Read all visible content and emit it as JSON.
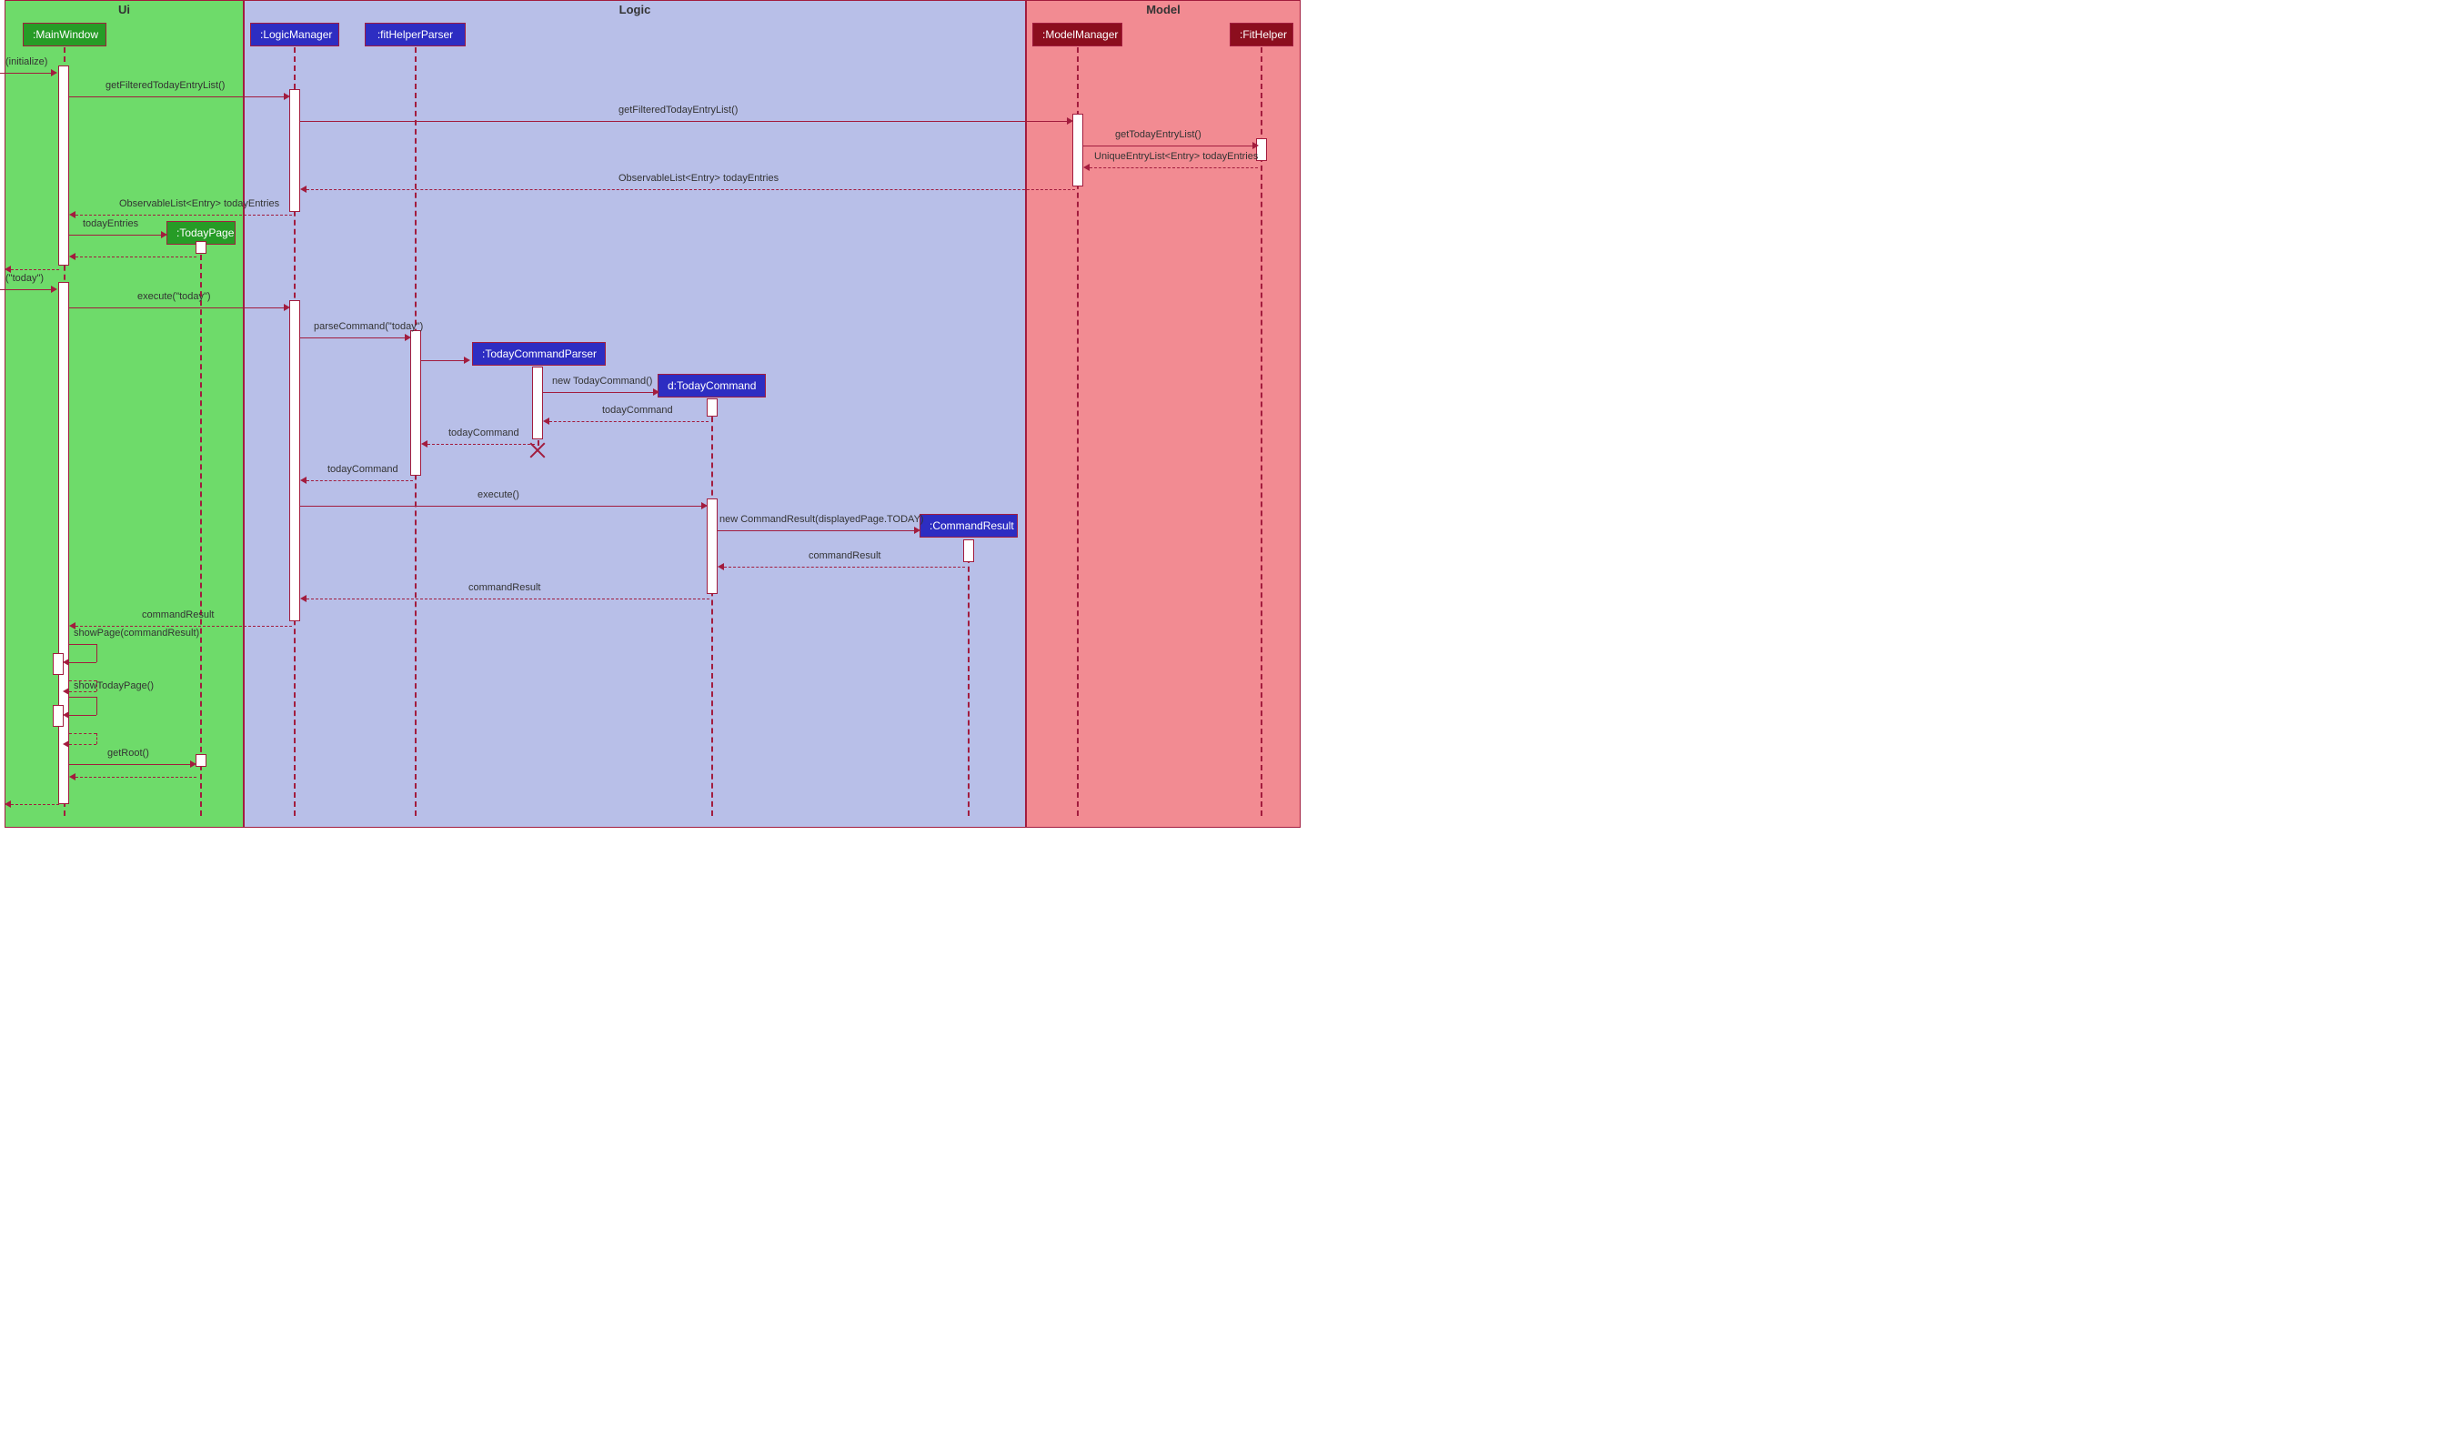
{
  "lanes": {
    "ui": "Ui",
    "logic": "Logic",
    "model": "Model"
  },
  "participants": {
    "main": ":MainWindow",
    "logic": ":LogicManager",
    "parser": ":fitHelperParser",
    "todayPage": ":TodayPage",
    "todayCommandParser": ":TodayCommandParser",
    "todayCommand": "d:TodayCommand",
    "commandResult": ":CommandResult",
    "modelManager": ":ModelManager",
    "fitHelper": ":FitHelper"
  },
  "messages": {
    "initialize": "(initialize)",
    "getFiltered1": "getFilteredTodayEntryList()",
    "getFiltered2": "getFilteredTodayEntryList()",
    "getTodayEntry": "getTodayEntryList()",
    "uniqueList": "UniqueEntryList<Entry> todayEntries",
    "observable1": "ObservableList<Entry> todayEntries",
    "observable2": "ObservableList<Entry> todayEntries",
    "todayEntries": "todayEntries",
    "todayInput": "(\"today\")",
    "executeToday": "execute(\"today\")",
    "parseCommand": "parseCommand(\"today\")",
    "newToday": "new TodayCommand()",
    "todayCommandRet1": "todayCommand",
    "todayCommandRet2": "todayCommand",
    "todayCommandRet3": "todayCommand",
    "execute": "execute()",
    "newCommandResult": "new CommandResult(displayedPage.TODAY)",
    "commandResultRet1": "commandResult",
    "commandResultRet2": "commandResult",
    "commandResultRet3": "commandResult",
    "showPage": "showPage(commandResult)",
    "showTodayPage": "showTodayPage()",
    "getRoot": "getRoot()"
  }
}
